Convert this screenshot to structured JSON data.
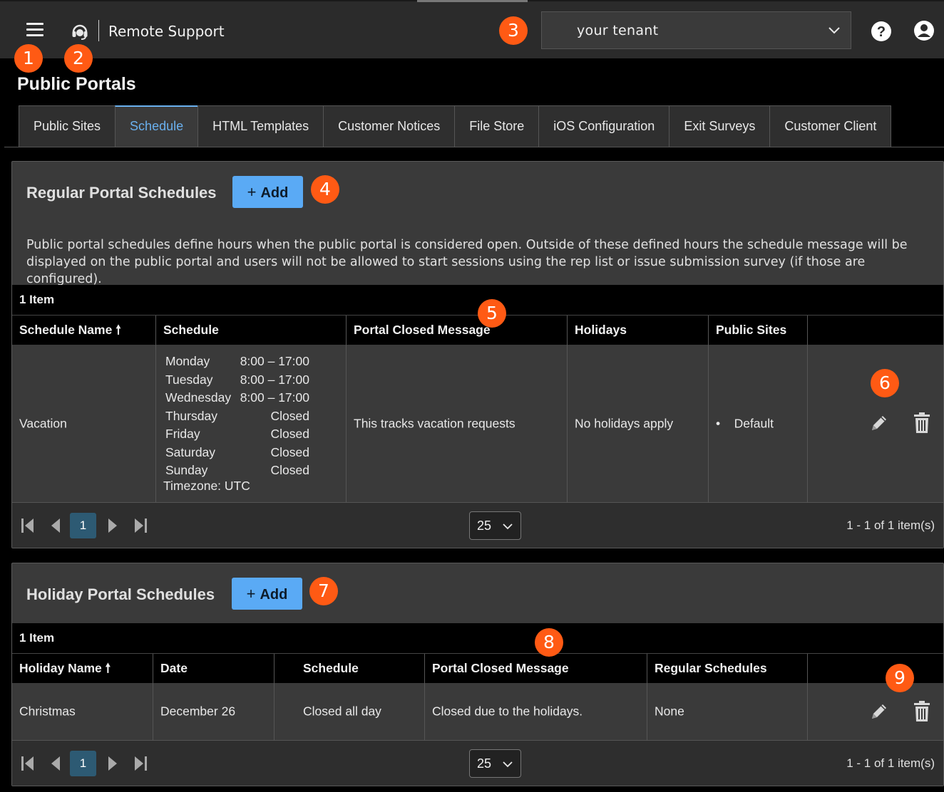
{
  "header": {
    "app_title": "Remote Support",
    "tenant": "your tenant"
  },
  "badges": [
    "1",
    "2",
    "3",
    "4",
    "5",
    "6",
    "7",
    "8",
    "9"
  ],
  "page_title": "Public Portals",
  "tabs": [
    {
      "label": "Public Sites",
      "active": false
    },
    {
      "label": "Schedule",
      "active": true
    },
    {
      "label": "HTML Templates",
      "active": false
    },
    {
      "label": "Customer Notices",
      "active": false
    },
    {
      "label": "File Store",
      "active": false
    },
    {
      "label": "iOS Configuration",
      "active": false
    },
    {
      "label": "Exit Surveys",
      "active": false
    },
    {
      "label": "Customer Client",
      "active": false
    }
  ],
  "regular": {
    "title": "Regular Portal Schedules",
    "add_label": "Add",
    "description": "Public portal schedules define hours when the public portal is considered open. Outside of these defined hours the schedule message will be displayed on the public portal and users will not be allowed to start sessions using the rep list or issue submission survey (if those are configured).",
    "count": "1 Item",
    "columns": [
      "Schedule Name",
      "Schedule",
      "Portal Closed Message",
      "Holidays",
      "Public Sites"
    ],
    "sort_arrow": "🠕",
    "rows": [
      {
        "name": "Vacation",
        "schedule": [
          {
            "day": "Monday",
            "hours": "8:00 – 17:00"
          },
          {
            "day": "Tuesday",
            "hours": "8:00 – 17:00"
          },
          {
            "day": "Wednesday",
            "hours": "8:00 – 17:00"
          },
          {
            "day": "Thursday",
            "hours": "Closed"
          },
          {
            "day": "Friday",
            "hours": "Closed"
          },
          {
            "day": "Saturday",
            "hours": "Closed"
          },
          {
            "day": "Sunday",
            "hours": "Closed"
          }
        ],
        "timezone": "Timezone: UTC",
        "closed_message": "This tracks vacation requests",
        "holidays": "No holidays apply",
        "public_sites": [
          "Default"
        ]
      }
    ],
    "pager": {
      "current_page": "1",
      "page_size": "25",
      "info": "1 - 1 of 1 item(s)"
    }
  },
  "holiday": {
    "title": "Holiday Portal Schedules",
    "add_label": "Add",
    "count": "1 Item",
    "columns": [
      "Holiday Name",
      "Date",
      "Schedule",
      "Portal Closed Message",
      "Regular Schedules"
    ],
    "rows": [
      {
        "name": "Christmas",
        "date": "December 26",
        "schedule": "Closed all day",
        "closed_message": "Closed due to the holidays.",
        "regular_schedules": "None"
      }
    ],
    "pager": {
      "current_page": "1",
      "page_size": "25",
      "info": "1 - 1 of 1 item(s)"
    }
  }
}
